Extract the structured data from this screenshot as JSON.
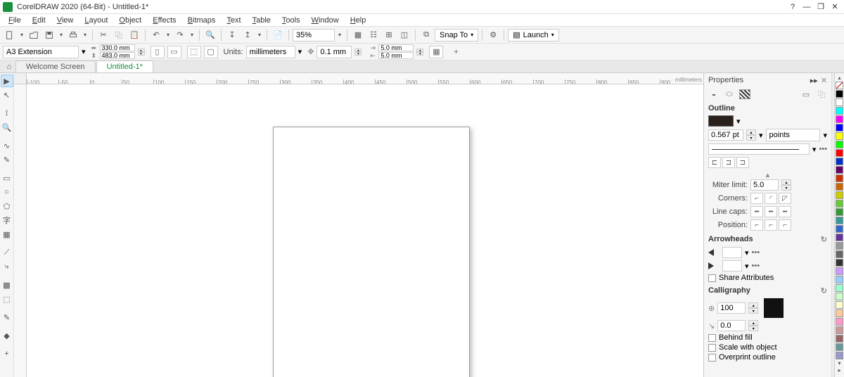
{
  "title": "CorelDRAW 2020 (64-Bit) - Untitled-1*",
  "menu": [
    "File",
    "Edit",
    "View",
    "Layout",
    "Object",
    "Effects",
    "Bitmaps",
    "Text",
    "Table",
    "Tools",
    "Window",
    "Help"
  ],
  "toolbar1": {
    "zoom": "35%",
    "snap_label": "Snap To",
    "launch_label": "Launch"
  },
  "propbar": {
    "page_preset": "A3 Extension",
    "width": "330.0 mm",
    "height": "483.0 mm",
    "units_label": "Units:",
    "units": "millimeters",
    "nudge": "0.1 mm",
    "dup_x": "5.0 mm",
    "dup_y": "5.0 mm"
  },
  "tabs": {
    "welcome": "Welcome Screen",
    "doc": "Untitled-1*"
  },
  "ruler": {
    "unit": "millimeters",
    "ticks": [
      "-100",
      "-50",
      "0",
      "50",
      "100",
      "150",
      "200",
      "250",
      "300",
      "350",
      "400",
      "450",
      "500",
      "550",
      "600",
      "650",
      "700",
      "750",
      "800",
      "850",
      "900"
    ]
  },
  "docker": {
    "title": "Properties",
    "outline": {
      "head": "Outline",
      "width": "0.567 pt",
      "units": "points",
      "miter_label": "Miter limit:",
      "miter": "5.0",
      "corners_label": "Corners:",
      "caps_label": "Line caps:",
      "pos_label": "Position:"
    },
    "arrow": {
      "head": "Arrowheads",
      "share": "Share Attributes"
    },
    "calli": {
      "head": "Calligraphy",
      "stretch": "100",
      "angle": "0.0"
    },
    "flags": {
      "behind": "Behind fill",
      "scale": "Scale with object",
      "overprint": "Overprint outline"
    },
    "tab_label": "Properties"
  },
  "palette_colors": [
    "#000000",
    "#ffffff",
    "#00ffff",
    "#ff00ff",
    "#0000ff",
    "#ffff00",
    "#00ff00",
    "#ff0000",
    "#0033cc",
    "#660066",
    "#cc3300",
    "#cc6600",
    "#cccc00",
    "#66cc33",
    "#339933",
    "#339999",
    "#3366cc",
    "#663399",
    "#999999",
    "#666666",
    "#333333",
    "#cc99ff",
    "#99ccff",
    "#99ffcc",
    "#ccffcc",
    "#ffffcc",
    "#ffcc99",
    "#ff99cc",
    "#cc9999",
    "#996666",
    "#669999",
    "#9999cc"
  ]
}
